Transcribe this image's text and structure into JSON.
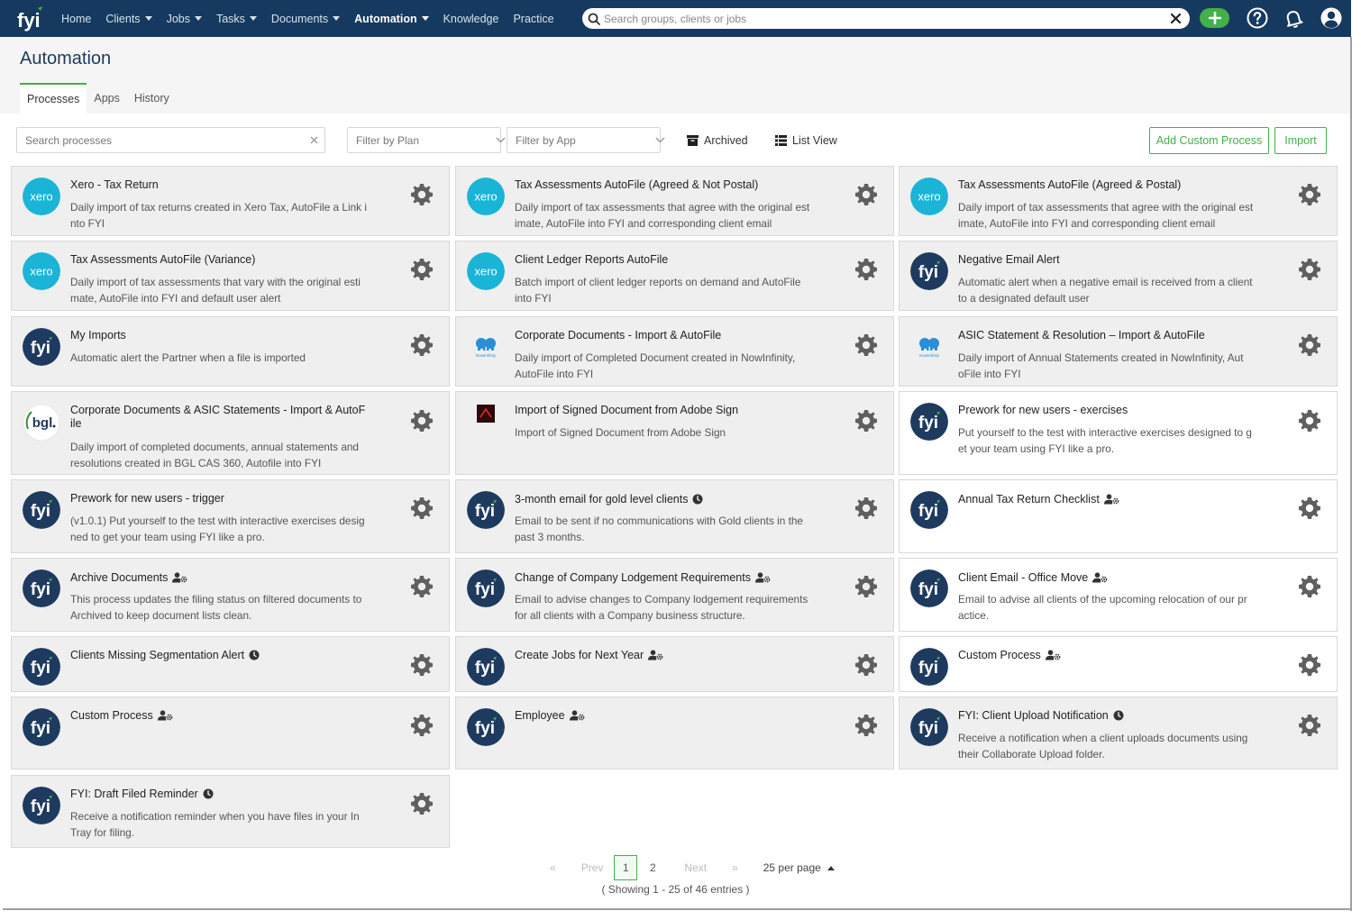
{
  "nav": {
    "logo": "fyi",
    "items": [
      {
        "label": "Home",
        "caret": false,
        "active": false
      },
      {
        "label": "Clients",
        "caret": true,
        "active": false
      },
      {
        "label": "Jobs",
        "caret": true,
        "active": false
      },
      {
        "label": "Tasks",
        "caret": true,
        "active": false
      },
      {
        "label": "Documents",
        "caret": true,
        "active": false
      },
      {
        "label": "Automation",
        "caret": true,
        "active": true
      },
      {
        "label": "Knowledge",
        "caret": false,
        "active": false
      },
      {
        "label": "Practice",
        "caret": false,
        "active": false
      }
    ],
    "search_placeholder": "Search groups, clients or jobs",
    "search_value": ""
  },
  "page": {
    "title": "Automation",
    "tabs": [
      {
        "label": "Processes",
        "active": true
      },
      {
        "label": "Apps",
        "active": false
      },
      {
        "label": "History",
        "active": false
      }
    ]
  },
  "toolbar": {
    "search_placeholder": "Search processes",
    "filter_plan_placeholder": "Filter by Plan",
    "filter_app_placeholder": "Filter by App",
    "archived_label": "Archived",
    "list_view_label": "List View",
    "add_custom_label": "Add Custom Process",
    "import_label": "Import"
  },
  "colors": {
    "brand_navy": "#163a5f",
    "accent_green": "#43b049",
    "xero_blue": "#1ab4d7",
    "fyi_navy": "#1e3a5f"
  },
  "cards": [
    {
      "logo": "xero",
      "title": "Xero - Tax Return",
      "desc": [
        "Daily import of tax returns created in Xero Tax, AutoFile a Link i",
        "nto FYI"
      ],
      "icon": ""
    },
    {
      "logo": "xero",
      "title": "Tax Assessments AutoFile (Agreed & Not Postal)",
      "desc": [
        "Daily import of tax assessments that agree with the original est",
        "imate, AutoFile into FYI and corresponding client email"
      ],
      "icon": ""
    },
    {
      "logo": "xero",
      "title": "Tax Assessments AutoFile (Agreed & Postal)",
      "desc": [
        "Daily import of tax assessments that agree with the original est",
        "imate, AutoFile into FYI and corresponding client email"
      ],
      "icon": ""
    },
    {
      "logo": "xero",
      "title": "Tax Assessments AutoFile (Variance)",
      "desc": [
        "Daily import of tax assessments that vary with the original esti",
        "mate, AutoFile into FYI and default user alert"
      ],
      "icon": ""
    },
    {
      "logo": "xero",
      "title": "Client Ledger Reports AutoFile",
      "desc": [
        "Batch import of client ledger reports on demand and AutoFile",
        "into FYI"
      ],
      "icon": ""
    },
    {
      "logo": "fyi",
      "title": "Negative Email Alert",
      "desc": [
        "Automatic alert when a negative email is received from a client",
        "to a designated default user"
      ],
      "icon": ""
    },
    {
      "logo": "fyi",
      "title": "My Imports",
      "desc": [
        "Automatic alert the Partner when a file is imported"
      ],
      "icon": ""
    },
    {
      "logo": "nowinfinity",
      "title": "Corporate Documents - Import & AutoFile",
      "desc": [
        "Daily import of Completed Document created in NowInfinity,",
        "AutoFile into FYI"
      ],
      "icon": ""
    },
    {
      "logo": "nowinfinity",
      "title": "ASIC Statement & Resolution – Import & AutoFile",
      "desc": [
        "Daily import of Annual Statements created in NowInfinity, Aut",
        "oFile into FYI"
      ],
      "icon": ""
    },
    {
      "logo": "bgl",
      "title": "Corporate Documents & ASIC Statements - Import & AutoF",
      "title2": "ile",
      "desc": [
        "Daily import of completed documents, annual statements and",
        "resolutions created in BGL CAS 360, Autofile into FYI"
      ],
      "icon": ""
    },
    {
      "logo": "adobe",
      "title": "Import of Signed Document from Adobe Sign",
      "desc": [
        "Import of Signed Document from Adobe Sign"
      ],
      "icon": ""
    },
    {
      "logo": "fyi",
      "title": "Prework for new users - exercises",
      "desc": [
        "Put yourself to the test with interactive exercises designed to g",
        "et your team using FYI like a pro."
      ],
      "icon": ""
    },
    {
      "logo": "fyi",
      "title": "Prework for new users - trigger",
      "desc": [
        "(v1.0.1) Put yourself to the test with interactive exercises desig",
        "ned to get your team using FYI like a pro."
      ],
      "icon": ""
    },
    {
      "logo": "fyi",
      "title": "3-month email for gold level clients",
      "desc": [
        "Email to be sent if no communications with Gold clients in the",
        "past 3 months."
      ],
      "icon": "clock"
    },
    {
      "logo": "fyi",
      "title": "Annual Tax Return Checklist",
      "desc": [],
      "icon": "user-gear"
    },
    {
      "logo": "fyi",
      "title": "Archive Documents",
      "desc": [
        "This process updates the filing status on filtered documents to",
        "Archived to keep document lists clean."
      ],
      "icon": "user-gear"
    },
    {
      "logo": "fyi",
      "title": "Change of Company Lodgement Requirements",
      "desc": [
        "Email to advise changes to Company lodgement requirements",
        "for all clients with a Company business structure."
      ],
      "icon": "user-gear"
    },
    {
      "logo": "fyi",
      "title": "Client Email - Office Move",
      "desc": [
        "Email to advise all clients of the upcoming relocation of our pr",
        "actice."
      ],
      "icon": "user-gear"
    },
    {
      "logo": "fyi",
      "title": "Clients Missing Segmentation Alert",
      "desc": [],
      "icon": "clock"
    },
    {
      "logo": "fyi",
      "title": "Create Jobs for Next Year",
      "desc": [],
      "icon": "user-gear"
    },
    {
      "logo": "fyi",
      "title": "Custom Process",
      "desc": [],
      "icon": "user-gear"
    },
    {
      "logo": "fyi",
      "title": "Custom Process",
      "desc": [],
      "icon": "user-gear"
    },
    {
      "logo": "fyi",
      "title": "Employee",
      "desc": [],
      "icon": "user-gear"
    },
    {
      "logo": "fyi",
      "title": "FYI: Client Upload Notification",
      "desc": [
        "Receive a notification when a client uploads documents using",
        "their Collaborate Upload folder."
      ],
      "icon": "clock"
    },
    {
      "logo": "fyi",
      "title": "FYI: Draft Filed Reminder",
      "desc": [
        "Receive a notification reminder when you have files in your In",
        "Tray for filing."
      ],
      "icon": "clock"
    }
  ],
  "pagination": {
    "first": "«",
    "prev": "Prev",
    "pages": [
      "1",
      "2"
    ],
    "current": "1",
    "next": "Next",
    "last": "»",
    "per_page": "25 per page",
    "showing": "( Showing 1 - 25 of 46 entries )"
  }
}
